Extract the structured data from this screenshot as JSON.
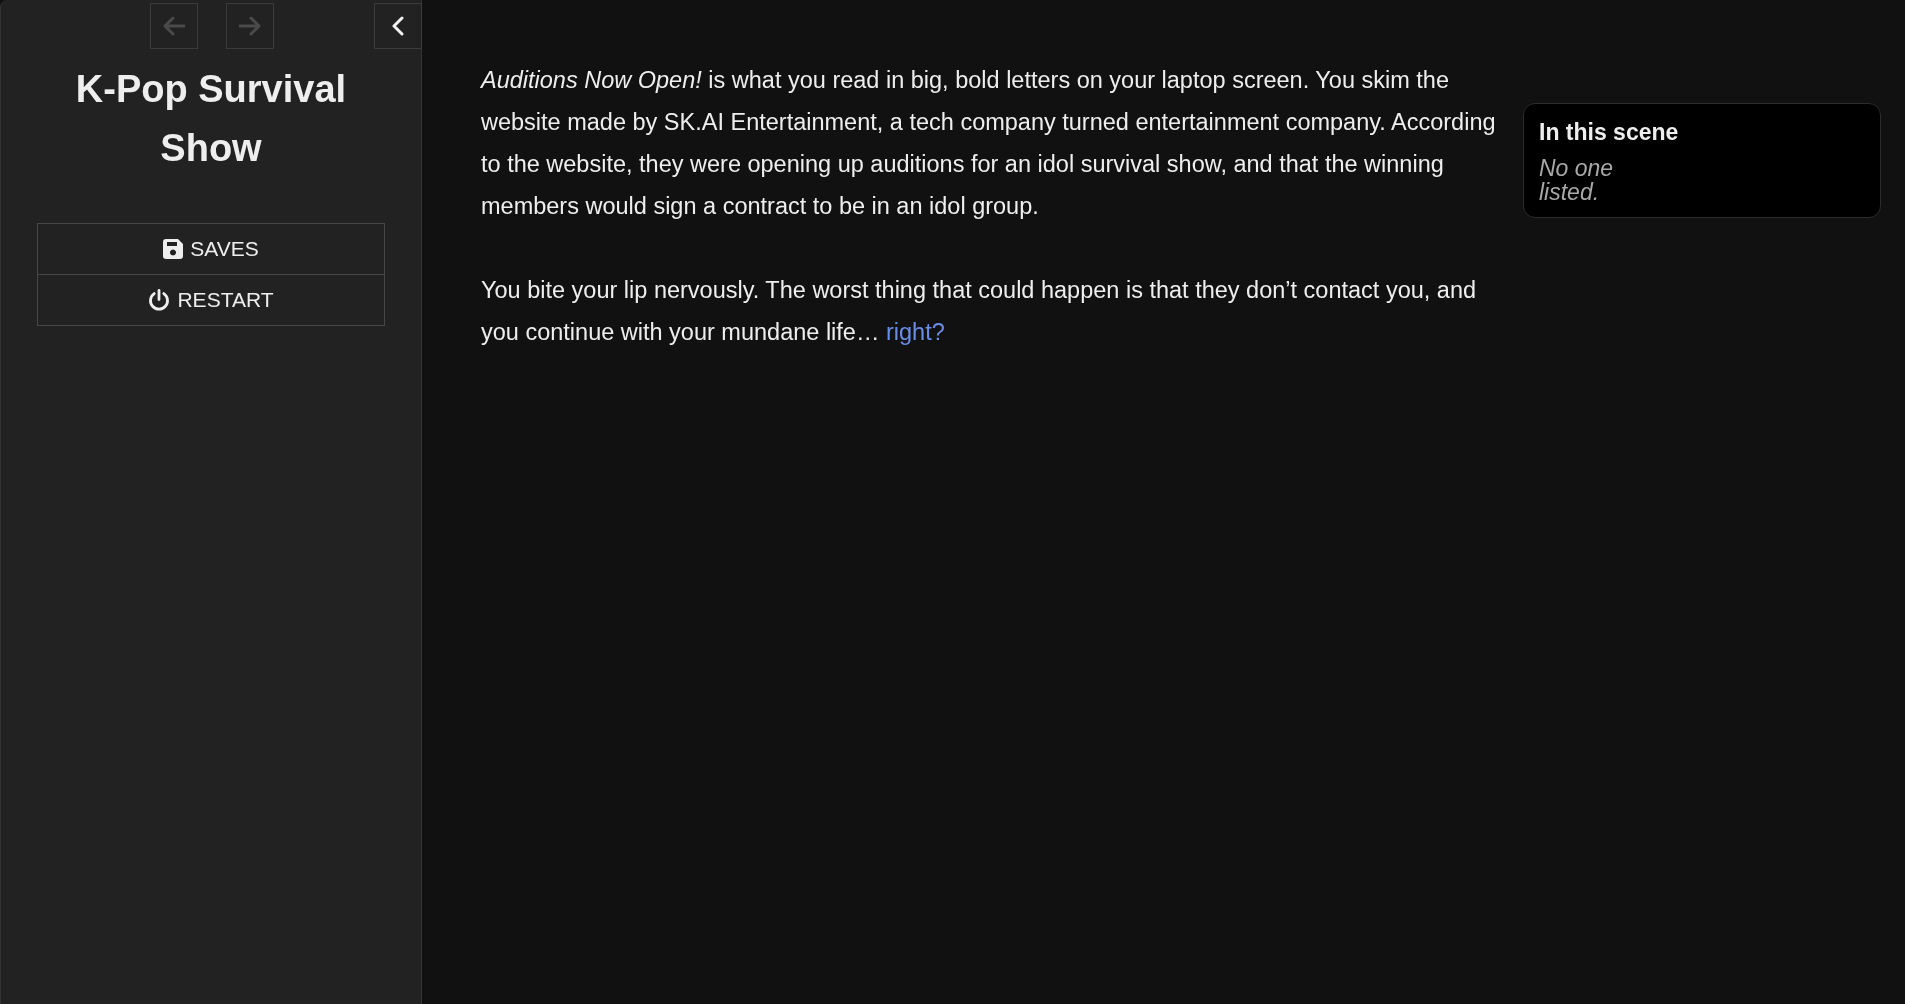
{
  "sidebar": {
    "nav": [
      {
        "kind": "back",
        "disabled": true
      },
      {
        "kind": "forward",
        "disabled": true
      }
    ],
    "title": "K-Pop Survival Show",
    "menu": [
      {
        "kind": "saves",
        "label": "SAVES"
      },
      {
        "kind": "restart",
        "label": "RESTART"
      }
    ]
  },
  "story": {
    "paragraphs": [
      {
        "text": "*Auditions Now Open!* is what you read in big, bold letters on your laptop screen. You skim the website made by SK.AI Entertainment, a tech company turned entertainment company. According to the website, they were opening up auditions for an idol survival show, and that the winning members would sign a contract to be in an idol group."
      },
      {
        "text": "You bite your lip nervously. The worst thing that could happen is that they don’t contact you, and you continue with your mundane life…",
        "link": "right?"
      }
    ]
  },
  "scene_panel": {
    "title": "In this scene",
    "note": "No one listed."
  }
}
